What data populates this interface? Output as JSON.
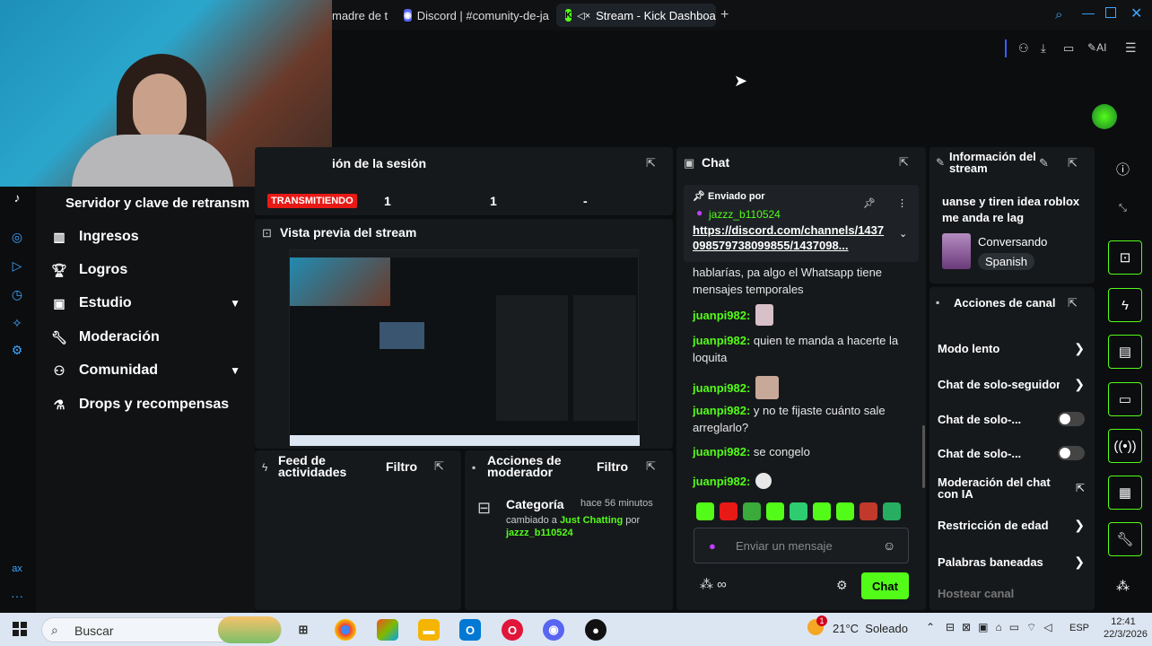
{
  "browser": {
    "tabs": [
      {
        "label": "madre de t",
        "icon": "generic-tab-icon"
      },
      {
        "label": "Discord | #comunity-de-ja",
        "icon": "discord-icon"
      },
      {
        "label": "Stream - Kick Dashboa",
        "icon": "kick-icon",
        "muted": true
      }
    ],
    "new_tab": "+",
    "toolbar_ai": "AI"
  },
  "sidebar": {
    "stream_key_label": "Servidor y clave de retransm",
    "live_badge": "TRANSMITIENDO",
    "items": [
      {
        "label": "Ingresos",
        "icon": "bar-chart-icon"
      },
      {
        "label": "Logros",
        "icon": "trophy-icon"
      },
      {
        "label": "Estudio",
        "icon": "studio-icon",
        "expandable": true
      },
      {
        "label": "Moderación",
        "icon": "wrench-icon"
      },
      {
        "label": "Comunidad",
        "icon": "people-icon",
        "expandable": true
      },
      {
        "label": "Drops y recompensas",
        "icon": "gift-icon"
      }
    ]
  },
  "session": {
    "title": "ión de la sesión",
    "stats": [
      "1",
      "1",
      "-"
    ]
  },
  "preview": {
    "title": "Vista previa del stream"
  },
  "feed": {
    "title": "Feed de actividades",
    "filter": "Filtro"
  },
  "mod_actions": {
    "title": "Acciones de moderador",
    "filter": "Filtro",
    "entry_title": "Categoría",
    "entry_time": "hace 56 minutos",
    "entry_text_1": "cambiado a",
    "entry_category": "Just Chatting",
    "entry_text_2": "por",
    "entry_user": "jazzz_b110524"
  },
  "chat": {
    "title": "Chat",
    "pinned_label": "Enviado por",
    "pinned_user": "jazzz_b110524",
    "pinned_link": "https://discord.com/channels/1437098579738099855/1437098...",
    "messages": [
      {
        "user": "",
        "text": "hablarías, pa algo el Whatsapp tiene mensajes temporales"
      },
      {
        "user": "juanpi982:",
        "text": "",
        "emote": true
      },
      {
        "user": "juanpi982:",
        "text": "quien te manda a hacerte la loquita"
      },
      {
        "user": "juanpi982:",
        "text": "",
        "emote": true
      },
      {
        "user": "juanpi982:",
        "text": "y no te fijaste cuánto sale arreglarlo?"
      },
      {
        "user": "juanpi982:",
        "text": "se congelo"
      },
      {
        "user": "juanpi982:",
        "text": "",
        "emote": true
      }
    ],
    "input_placeholder": "Enviar un mensaje",
    "send_button": "Chat"
  },
  "stream_info": {
    "title": "Información del stream",
    "stream_title": "uanse y tiren idea roblox me anda re lag",
    "category": "Conversando",
    "language": "Spanish"
  },
  "channel_actions": {
    "title": "Acciones de canal",
    "items": [
      {
        "label": "Modo lento",
        "control": "arrow"
      },
      {
        "label": "Chat de solo-seguidores",
        "control": "arrow"
      },
      {
        "label": "Chat de solo-...",
        "control": "toggle"
      },
      {
        "label": "Chat de solo-...",
        "control": "toggle"
      },
      {
        "label": "Moderación del chat con IA",
        "control": "external"
      },
      {
        "label": "Restricción de edad",
        "control": "arrow"
      },
      {
        "label": "Palabras baneadas",
        "control": "arrow"
      },
      {
        "label": "Hostear canal",
        "control": "none"
      }
    ]
  },
  "taskbar": {
    "search_placeholder": "Buscar",
    "weather": "21°C  Soleado",
    "language": "ESP",
    "time": "12:41",
    "date": "22/3/2026",
    "notification_count": "1"
  },
  "colors": {
    "accent": "#53fc18",
    "live_red": "#e91916",
    "panel": "#16191c",
    "background": "#0b0d0f"
  }
}
